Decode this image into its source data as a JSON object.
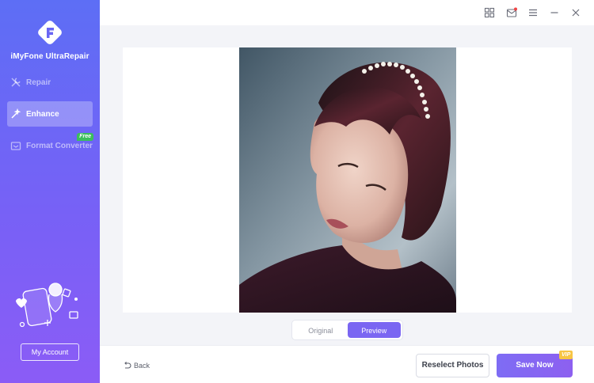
{
  "app": {
    "name": "iMyFone UltraRepair"
  },
  "sidebar": {
    "items": [
      {
        "label": "Repair",
        "icon": "tools-icon"
      },
      {
        "label": "Enhance",
        "icon": "magic-wand-icon",
        "active": true
      },
      {
        "label": "Format Converter",
        "icon": "image-convert-icon",
        "badge": "Free"
      }
    ],
    "account_label": "My Account"
  },
  "titlebar": {
    "icons": [
      "grid-icon",
      "mail-icon",
      "menu-icon",
      "minimize-icon",
      "close-icon"
    ]
  },
  "main": {
    "image_alt": "Enhanced portrait photo",
    "toggle": {
      "original_label": "Original",
      "preview_label": "Preview",
      "selected": "Preview"
    }
  },
  "footer": {
    "back_label": "Back",
    "reselect_label": "Reselect Photos",
    "save_label": "Save Now",
    "vip_badge": "VIP"
  },
  "colors": {
    "accent": "#7a66f2",
    "sidebar_top": "#5d6ef5",
    "sidebar_bottom": "#8b5cf6",
    "free_badge": "#3bbf5c",
    "vip_badge": "#f7c545"
  }
}
